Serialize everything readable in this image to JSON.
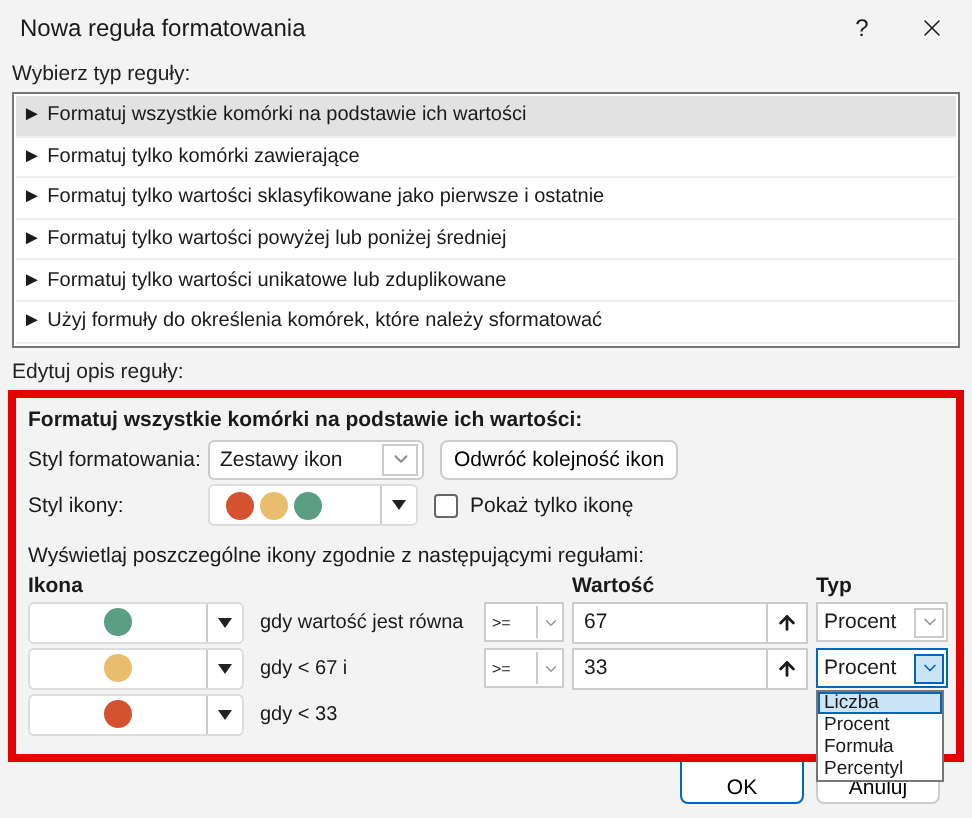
{
  "window": {
    "title": "Nowa reguła formatowania",
    "help": "?"
  },
  "rule_type": {
    "label": "Wybierz typ reguły:",
    "items": [
      {
        "label": "► Formatuj wszystkie komórki na podstawie ich wartości",
        "selected": true
      },
      {
        "label": "► Formatuj tylko komórki zawierające",
        "selected": false
      },
      {
        "label": "► Formatuj tylko wartości sklasyfikowane jako pierwsze i ostatnie",
        "selected": false
      },
      {
        "label": "► Formatuj tylko wartości powyżej lub poniżej średniej",
        "selected": false
      },
      {
        "label": "► Formatuj tylko wartości unikatowe lub zduplikowane",
        "selected": false
      },
      {
        "label": "► Użyj formuły do określenia komórek, które należy sformatować",
        "selected": false
      }
    ]
  },
  "description": {
    "label": "Edytuj opis reguły:",
    "heading": "Formatuj wszystkie komórki na podstawie ich wartości:",
    "format_style": {
      "label": "Styl formatowania:",
      "value": "Zestawy ikon"
    },
    "reverse_button": "Odwróć kolejność ikon",
    "icon_style": {
      "label": "Styl ikony:",
      "icons": [
        {
          "color": "#d4522e"
        },
        {
          "color": "#e8bd6e"
        },
        {
          "color": "#5a9e84"
        }
      ]
    },
    "show_icon_only": {
      "label": "Pokaż tylko ikonę",
      "checked": false
    },
    "instruction": "Wyświetlaj poszczególne ikony zgodnie z następującymi regułami:",
    "columns": {
      "icon": "Ikona",
      "value": "Wartość",
      "type": "Typ"
    },
    "rules": [
      {
        "color": "#5a9e84",
        "condition": "gdy wartość jest równa",
        "operator": ">=",
        "value": "67",
        "type": "Procent",
        "type_open": false
      },
      {
        "color": "#e8bd6e",
        "condition": "gdy < 67 i",
        "operator": ">=",
        "value": "33",
        "type": "Procent",
        "type_open": true
      },
      {
        "color": "#d4522e",
        "condition": "gdy < 33"
      }
    ],
    "type_options": [
      {
        "label": "Liczba",
        "selected": true
      },
      {
        "label": "Procent",
        "selected": false
      },
      {
        "label": "Formuła",
        "selected": false
      },
      {
        "label": "Percentyl",
        "selected": false
      }
    ]
  },
  "buttons": [
    {
      "label": "OK",
      "default": true
    },
    {
      "label": "Anuluj",
      "default": false
    }
  ]
}
